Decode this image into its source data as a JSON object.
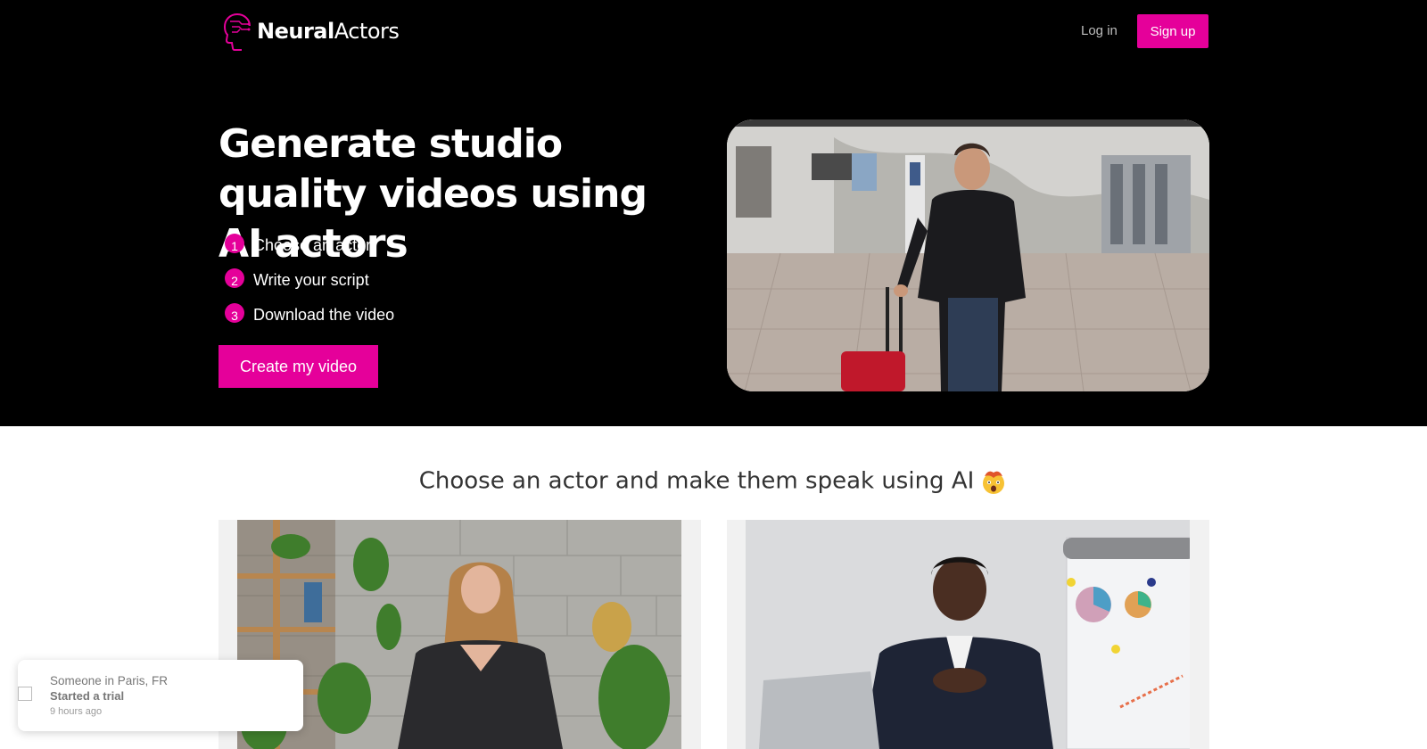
{
  "header": {
    "logo_bold": "Neural",
    "logo_light": "Actors",
    "login_label": "Log in",
    "signup_label": "Sign up"
  },
  "hero": {
    "headline": "Generate studio quality videos using AI actors",
    "steps": [
      {
        "num": "1",
        "label": "Choose an actor"
      },
      {
        "num": "2",
        "label": "Write your script"
      },
      {
        "num": "3",
        "label": "Download the video"
      }
    ],
    "cta_label": "Create my video"
  },
  "section": {
    "title": "Choose an actor and make them speak using AI"
  },
  "toast": {
    "line1": "Someone in Paris, FR",
    "line2": "Started a trial",
    "line3": "9 hours ago"
  },
  "colors": {
    "accent": "#e5009a",
    "hero_bg": "#000000"
  }
}
